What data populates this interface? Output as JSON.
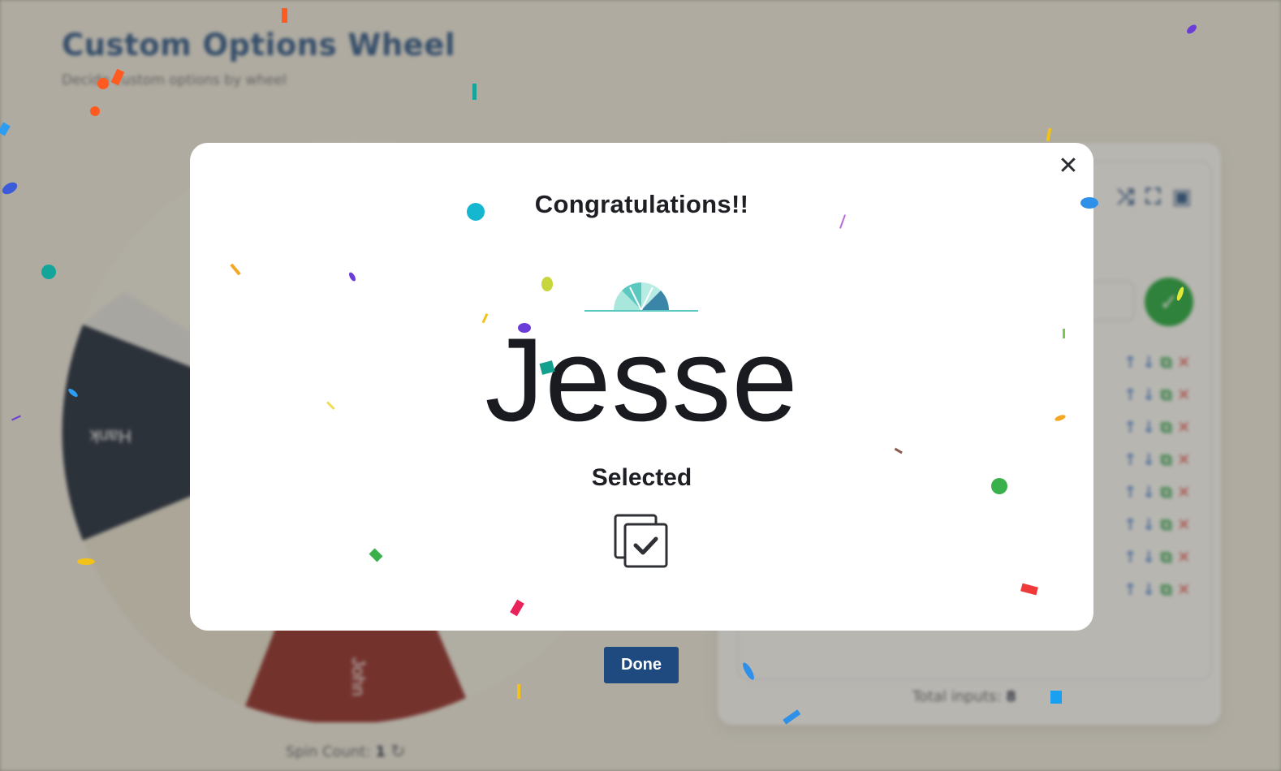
{
  "app": {
    "title": "Custom Options Wheel",
    "subtitle": "Decide custom options by wheel"
  },
  "wheel": {
    "segments": [
      {
        "label": "Hank",
        "color": "#0f1c33",
        "text_color": "#ffffff"
      },
      {
        "label": "John",
        "color": "#8b1d1d",
        "text_color": "#ffffff"
      }
    ],
    "spin_count_label": "Spin Count:",
    "spin_count": "1"
  },
  "options_panel": {
    "total_inputs_label": "Total inputs:",
    "total_inputs": "8",
    "row_count": 8
  },
  "modal": {
    "title": "Congratulations!!",
    "winner": "Jesse",
    "selected_label": "Selected",
    "close_symbol": "✕"
  },
  "done_button": {
    "label": "Done"
  },
  "colors": {
    "accent": "#1f4a7f",
    "title_blue": "#1f4d86",
    "add_green": "#13a534"
  },
  "icons": [
    "close-icon",
    "copy-check-icon",
    "shuffle-icon",
    "fullscreen-icon",
    "save-icon",
    "reset-icon",
    "check-icon"
  ]
}
